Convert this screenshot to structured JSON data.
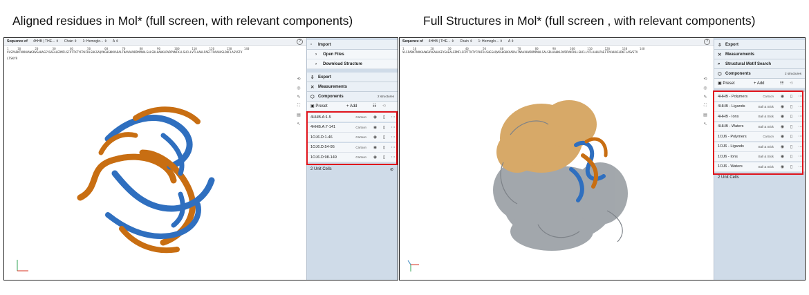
{
  "titles": {
    "left": "Aligned residues in Mol* (full screen, with relevant components)",
    "right": "Full Structures in Mol* (full screen , with relevant components)"
  },
  "seqbar": {
    "label": "Sequence of",
    "structure": "4HHB | THE...",
    "mode": "Chain",
    "entity": "1: Hemoglo...",
    "chain": "A",
    "help": "?"
  },
  "sequence": {
    "line1": "VLSPADKTNVKAAWGKVGAHAGEYGAEALERMFLSFPTTKTYFPHFDLSHGSAQVKGHGKKVADALTNAVAHVDDMPNALSALSDLHAHKLRVDPVNFKLLSHCLLVTLAAHLPAEFTPAVHASLDKFLASVSTV",
    "line2": "LTSKYR",
    "nums": "1     10        20        30        40        50        60        70        80        90        100       110       120       130       140"
  },
  "left_panel": {
    "import": "Import",
    "open_files": "Open Files",
    "download": "Download Structure",
    "export": "Export",
    "measurements": "Measurements",
    "components": "Components",
    "components_count": "2 structures",
    "preset": "Preset",
    "add": "+ Add",
    "items": [
      {
        "name": "4HHB.A:1-5",
        "rep": "Cartoon"
      },
      {
        "name": "4HHB.A:7-141",
        "rep": "Cartoon"
      },
      {
        "name": "1OJ6.D:1-46",
        "rep": "Cartoon"
      },
      {
        "name": "1OJ6.D:54-95",
        "rep": "Cartoon"
      },
      {
        "name": "1OJ6.D:98-149",
        "rep": "Cartoon"
      }
    ],
    "unit_cells": "2 Unit Cells"
  },
  "right_panel": {
    "export": "Export",
    "measurements": "Measurements",
    "motif": "Structural Motif Search",
    "components": "Components",
    "components_count": "2 structures",
    "preset": "Preset",
    "add": "+ Add",
    "items": [
      {
        "name": "4HHB - Polymers",
        "rep": "Cartoon"
      },
      {
        "name": "4HHB - Ligands",
        "rep": "Ball & Stick"
      },
      {
        "name": "4HHB - Ions",
        "rep": "Ball & Stick"
      },
      {
        "name": "4HHB - Waters",
        "rep": "Ball & Stick"
      },
      {
        "name": "1OJ6 - Polymers",
        "rep": "Cartoon"
      },
      {
        "name": "1OJ6 - Ligands",
        "rep": "Ball & Stick"
      },
      {
        "name": "1OJ6 - Ions",
        "rep": "Ball & Stick"
      },
      {
        "name": "1OJ6 - Waters",
        "rep": "Ball & Stick"
      }
    ],
    "unit_cells": "2 Unit Cells"
  },
  "colors": {
    "highlight": "#e0131b",
    "blue": "#2f6fbf",
    "orange": "#c86e12",
    "tan": "#d7a968",
    "grey": "#9ea3a8"
  }
}
